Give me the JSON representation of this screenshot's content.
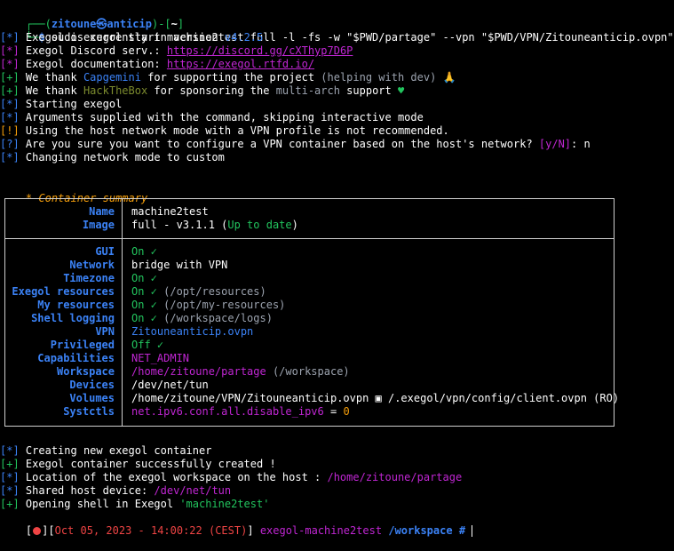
{
  "prompt": {
    "user": "zitoune",
    "host": "anticip",
    "path": "~",
    "command": "sudo exegol start machine2test full -l -fs -w \"$PWD/partage\" --vpn \"$PWD/VPN/Zitouneanticip.ovpn\""
  },
  "log": [
    {
      "tag": "*",
      "tag_color": "blue",
      "parts": [
        {
          "t": "Exegol is currently in version ",
          "c": "white"
        },
        {
          "t": "v4.2.5",
          "c": "blue"
        }
      ]
    },
    {
      "tag": "*",
      "tag_color": "purple",
      "parts": [
        {
          "t": "Exegol Discord serv.: ",
          "c": "white"
        },
        {
          "t": "https://discord.gg/cXThyp7D6P",
          "c": "purple",
          "link": true
        }
      ]
    },
    {
      "tag": "*",
      "tag_color": "purple",
      "parts": [
        {
          "t": "Exegol documentation: ",
          "c": "white"
        },
        {
          "t": "https://exegol.rtfd.io/",
          "c": "purple",
          "link": true
        }
      ]
    },
    {
      "tag": "+",
      "tag_color": "green",
      "parts": [
        {
          "t": "We thank ",
          "c": "white"
        },
        {
          "t": "Capgemini",
          "c": "blue"
        },
        {
          "t": " for supporting the project ",
          "c": "white"
        },
        {
          "t": "(helping with dev)",
          "c": "grey"
        },
        {
          "t": " 🙏",
          "c": "white"
        }
      ]
    },
    {
      "tag": "+",
      "tag_color": "green",
      "parts": [
        {
          "t": "We thank ",
          "c": "white"
        },
        {
          "t": "HackTheBox",
          "c": "olive"
        },
        {
          "t": " for sponsoring the ",
          "c": "white"
        },
        {
          "t": "multi-arch",
          "c": "grey"
        },
        {
          "t": " support ",
          "c": "white"
        },
        {
          "t": "♥",
          "c": "green"
        }
      ]
    },
    {
      "tag": "*",
      "tag_color": "blue",
      "parts": [
        {
          "t": "Starting exegol",
          "c": "white"
        }
      ]
    },
    {
      "tag": "*",
      "tag_color": "blue",
      "parts": [
        {
          "t": "Arguments supplied with the command, skipping interactive mode",
          "c": "white"
        }
      ]
    },
    {
      "tag": "!",
      "tag_color": "orange",
      "parts": [
        {
          "t": "Using the host network mode with a VPN profile is not recommended.",
          "c": "white"
        }
      ]
    },
    {
      "tag": "?",
      "tag_color": "blue",
      "parts": [
        {
          "t": "Are you sure you want to configure a VPN container based on the host's network? ",
          "c": "white"
        },
        {
          "t": "[y/N]",
          "c": "purple"
        },
        {
          "t": ": n",
          "c": "white"
        }
      ]
    },
    {
      "tag": "*",
      "tag_color": "blue",
      "parts": [
        {
          "t": "Changing network mode to custom",
          "c": "white"
        }
      ]
    }
  ],
  "summary_title": "Container summary",
  "summary_star": "*",
  "summary_header": [
    {
      "key": "Name",
      "parts": [
        {
          "t": "machine2test",
          "c": "white"
        }
      ]
    },
    {
      "key": "Image",
      "parts": [
        {
          "t": "full - v3.1.1 (",
          "c": "white"
        },
        {
          "t": "Up to date",
          "c": "green"
        },
        {
          "t": ")",
          "c": "white"
        }
      ]
    }
  ],
  "summary_rows": [
    {
      "key": "GUI",
      "parts": [
        {
          "t": "On ✓",
          "c": "green"
        }
      ]
    },
    {
      "key": "Network",
      "parts": [
        {
          "t": "bridge with VPN",
          "c": "white"
        }
      ]
    },
    {
      "key": "Timezone",
      "parts": [
        {
          "t": "On ✓",
          "c": "green"
        }
      ]
    },
    {
      "key": "Exegol resources",
      "parts": [
        {
          "t": "On ✓",
          "c": "green"
        },
        {
          "t": " (/opt/resources)",
          "c": "grey"
        }
      ]
    },
    {
      "key": "My resources",
      "parts": [
        {
          "t": "On ✓",
          "c": "green"
        },
        {
          "t": " (/opt/my-resources)",
          "c": "grey"
        }
      ]
    },
    {
      "key": "Shell logging",
      "parts": [
        {
          "t": "On ✓",
          "c": "green"
        },
        {
          "t": " (/workspace/logs)",
          "c": "grey"
        }
      ]
    },
    {
      "key": "VPN",
      "parts": [
        {
          "t": "Zitouneanticip.ovpn",
          "c": "blue"
        }
      ]
    },
    {
      "key": "Privileged",
      "parts": [
        {
          "t": "Off ✓",
          "c": "green"
        }
      ]
    },
    {
      "key": "Capabilities",
      "parts": [
        {
          "t": "NET_ADMIN",
          "c": "purple"
        }
      ]
    },
    {
      "key": "Workspace",
      "parts": [
        {
          "t": "/home/zitoune/partage",
          "c": "purple"
        },
        {
          "t": " (/workspace)",
          "c": "grey"
        }
      ]
    },
    {
      "key": "Devices",
      "parts": [
        {
          "t": "/dev/net/tun",
          "c": "white"
        }
      ]
    },
    {
      "key": "Volumes",
      "parts": [
        {
          "t": "/home/zitoune/VPN/Zitouneanticip.ovpn ▣ /.exegol/vpn/config/client.ovpn (RO)",
          "c": "white"
        }
      ]
    },
    {
      "key": "Systctls",
      "parts": [
        {
          "t": "net.ipv6.conf.all.disable_ipv6",
          "c": "purple"
        },
        {
          "t": " = ",
          "c": "white"
        },
        {
          "t": "0",
          "c": "orange"
        }
      ]
    }
  ],
  "log2": [
    {
      "tag": "*",
      "tag_color": "blue",
      "parts": [
        {
          "t": "Creating new exegol container",
          "c": "white"
        }
      ]
    },
    {
      "tag": "+",
      "tag_color": "green",
      "parts": [
        {
          "t": "Exegol container successfully created !",
          "c": "white"
        }
      ]
    },
    {
      "tag": "*",
      "tag_color": "blue",
      "parts": [
        {
          "t": "Location of the exegol workspace on the host : ",
          "c": "white"
        },
        {
          "t": "/home/zitoune/partage",
          "c": "purple"
        }
      ]
    },
    {
      "tag": "*",
      "tag_color": "blue",
      "parts": [
        {
          "t": "Shared host device: ",
          "c": "white"
        },
        {
          "t": "/dev/net/tun",
          "c": "purple"
        }
      ]
    },
    {
      "tag": "+",
      "tag_color": "green",
      "parts": [
        {
          "t": "Opening shell in Exegol ",
          "c": "white"
        },
        {
          "t": "'machine2test'",
          "c": "green"
        }
      ]
    }
  ],
  "shell_prompt": {
    "timestamp": "Oct 05, 2023 - 14:00:22 (CEST)",
    "container": "exegol-machine2test",
    "cwd": "/workspace",
    "symbol": "#"
  }
}
